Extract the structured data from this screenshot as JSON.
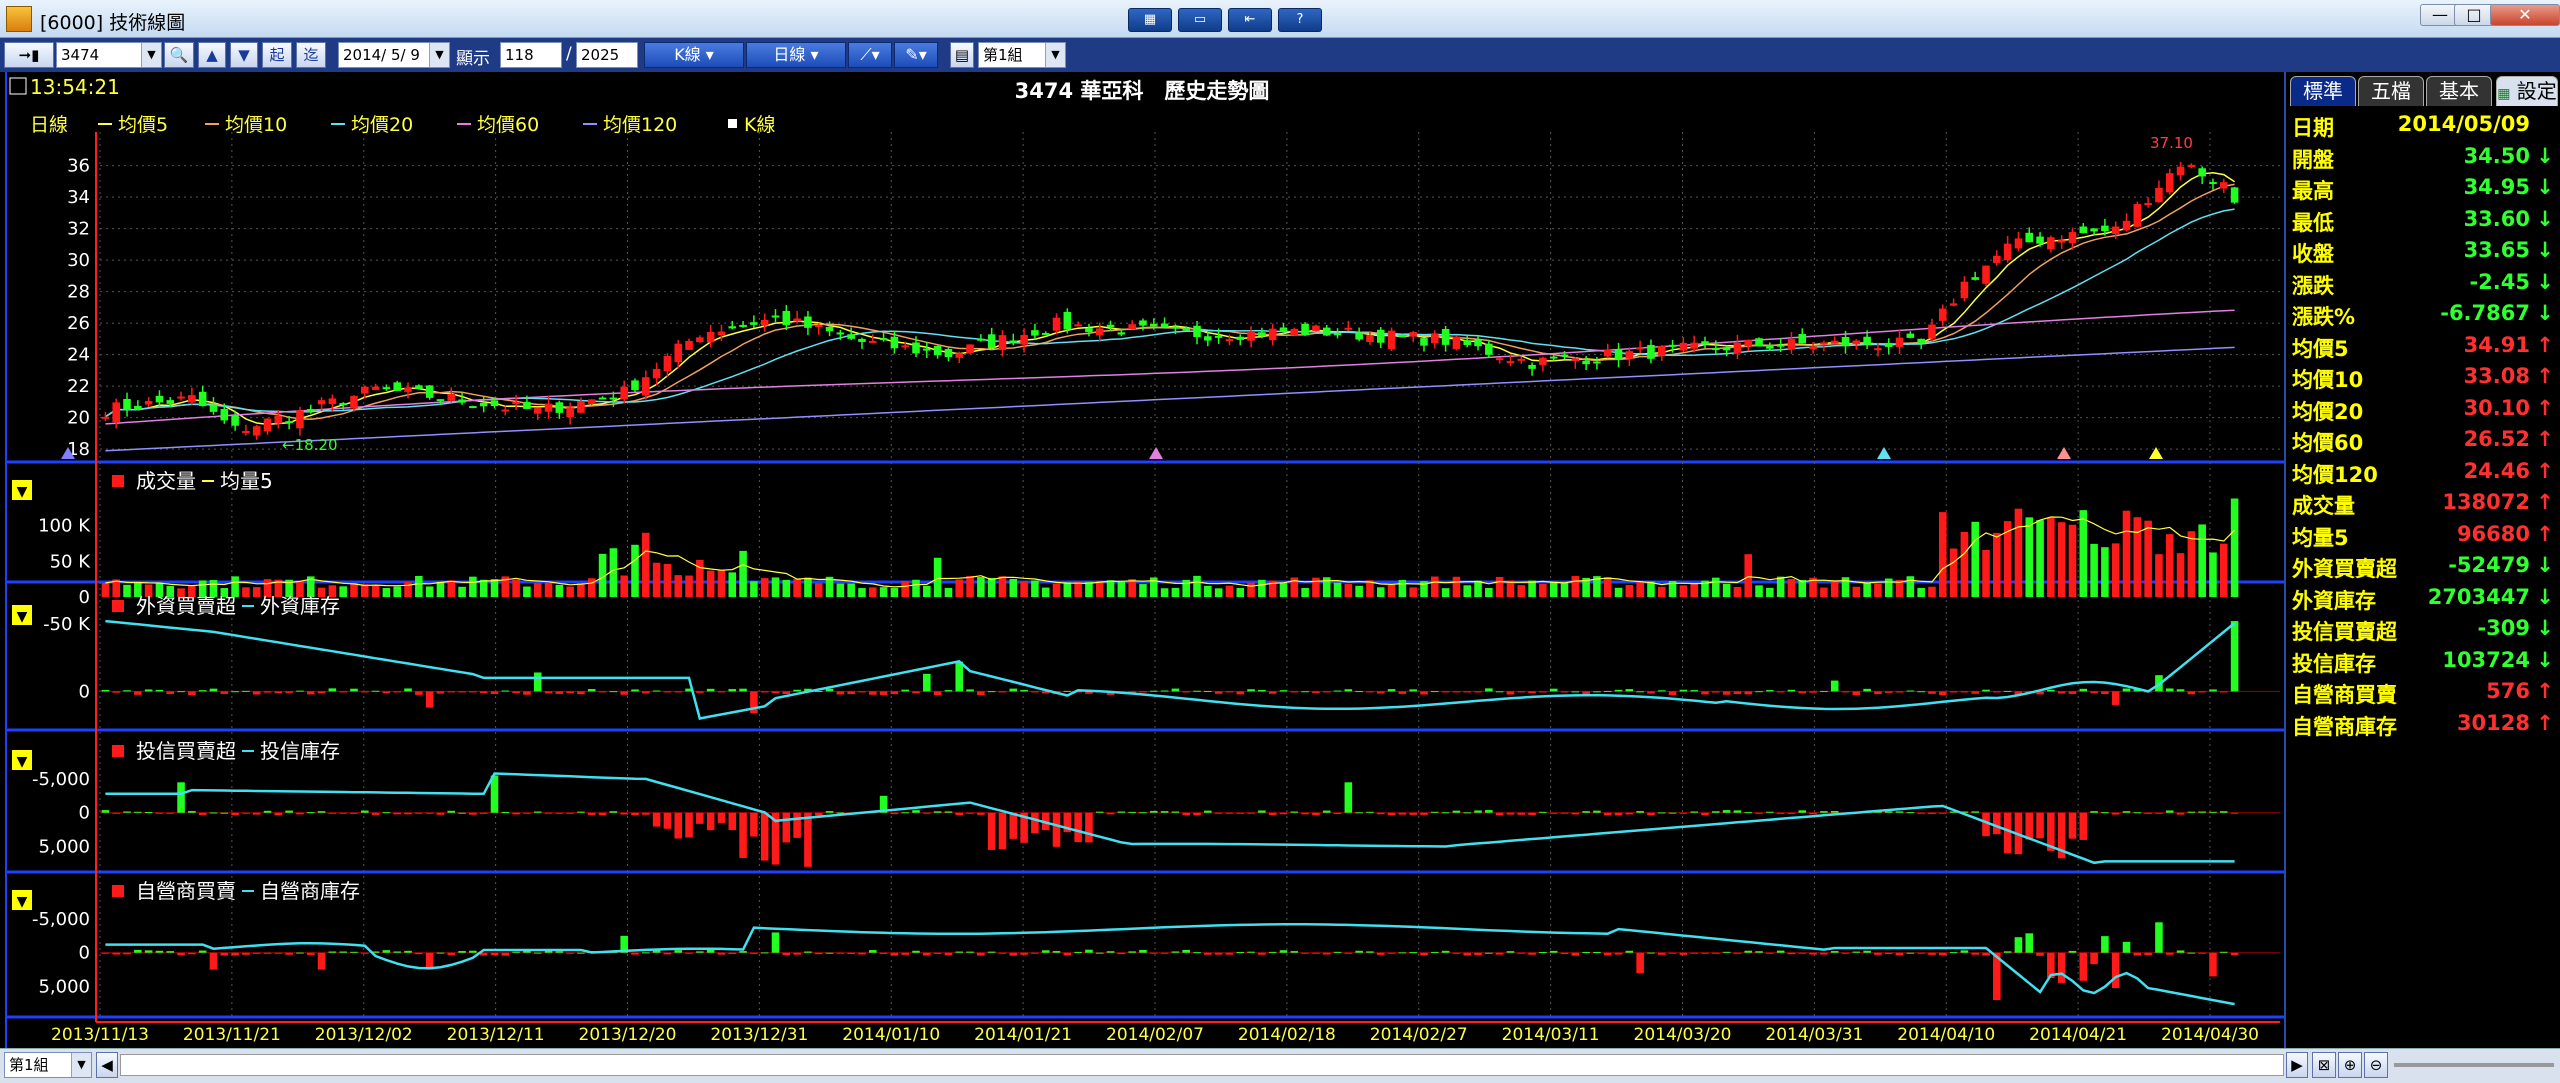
{
  "window": {
    "title": "[6000] 技術線圖",
    "btn_min": "—",
    "btn_max": "□",
    "btn_close": "✕"
  },
  "toolbar": {
    "stock_code": "3474",
    "start_label": "起",
    "end_label": "迄",
    "date": "2014/ 5/ 9",
    "show_label": "顯示",
    "show_count": "118",
    "show_sep": "/",
    "total_count": "2025",
    "kline_label": "K線",
    "period_label": "日線",
    "group_label": "第1組"
  },
  "chart": {
    "time": "13:54:21",
    "title": "3474 華亞科　歷史走勢圖",
    "legend": [
      {
        "label": "日線",
        "color": "#ffff40"
      },
      {
        "label": "均價5",
        "color": "#ffff40"
      },
      {
        "label": "均價10",
        "color": "#f0a060"
      },
      {
        "label": "均價20",
        "color": "#60e0f0"
      },
      {
        "label": "均價60",
        "color": "#e080e0"
      },
      {
        "label": "均價120",
        "color": "#9090ff"
      },
      {
        "label": "K線",
        "color": "#ffffff"
      }
    ],
    "high_mark": "37.10",
    "low_mark": "18.20",
    "panels": {
      "volume": {
        "legend": [
          "成交量",
          "均量5"
        ]
      },
      "foreign": {
        "legend": [
          "外資買賣超",
          "外資庫存"
        ]
      },
      "trust": {
        "legend": [
          "投信買賣超",
          "投信庫存"
        ]
      },
      "dealer": {
        "legend": [
          "自營商買賣",
          "自營商庫存"
        ]
      }
    },
    "dates": [
      "2013/11/13",
      "2013/11/21",
      "2013/12/02",
      "2013/12/11",
      "2013/12/20",
      "2013/12/31",
      "2014/01/10",
      "2014/01/21",
      "2014/02/07",
      "2014/02/18",
      "2014/02/27",
      "2014/03/11",
      "2014/03/20",
      "2014/03/31",
      "2014/04/10",
      "2014/04/21",
      "2014/04/30"
    ]
  },
  "chart_data": {
    "type": "line",
    "title": "3474 華亞科　歷史走勢圖",
    "price_ticks": [
      18,
      20,
      22,
      24,
      26,
      28,
      30,
      32,
      34,
      36
    ],
    "volume_ticks": [
      "100 K",
      "50 K",
      "0"
    ],
    "foreign_ticks": [
      "0",
      "-50 K"
    ],
    "trust_ticks": [
      "5,000",
      "0",
      "-5,000"
    ],
    "dealer_ticks": [
      "5,000",
      "0",
      "-5,000"
    ],
    "ylim_price": [
      17.5,
      37.5
    ],
    "close_anchors": [
      [
        0,
        20.5
      ],
      [
        8,
        21.2
      ],
      [
        12,
        19.2
      ],
      [
        18,
        20.3
      ],
      [
        25,
        21.8
      ],
      [
        32,
        21.2
      ],
      [
        40,
        20.4
      ],
      [
        48,
        21.6
      ],
      [
        55,
        25.4
      ],
      [
        62,
        26.3
      ],
      [
        70,
        24.8
      ],
      [
        78,
        24.0
      ],
      [
        88,
        25.9
      ],
      [
        100,
        25.3
      ],
      [
        112,
        25.5
      ],
      [
        124,
        24.9
      ],
      [
        132,
        23.5
      ],
      [
        140,
        24.0
      ],
      [
        152,
        24.6
      ],
      [
        163,
        24.7
      ],
      [
        168,
        24.6
      ],
      [
        172,
        28.5
      ],
      [
        176,
        30.8
      ],
      [
        180,
        31.5
      ],
      [
        186,
        31.9
      ],
      [
        192,
        36.2
      ],
      [
        196,
        34.8
      ],
      [
        197,
        33.65
      ]
    ],
    "ma_end": {
      "ma5": 34.91,
      "ma10": 33.08,
      "ma20": 30.1,
      "ma60": 26.52,
      "ma120": 24.46
    },
    "volume_end": 138072,
    "volume_ma5_end": 96680
  },
  "sidebar": {
    "tabs": [
      "標準",
      "五檔",
      "基本"
    ],
    "settings_label": "設定",
    "rows": [
      {
        "label": "日期",
        "value": "2014/05/09",
        "color": "#ffff00",
        "arrow": ""
      },
      {
        "label": "開盤",
        "value": "34.50",
        "color": "#30ff30",
        "arrow": "↓"
      },
      {
        "label": "最高",
        "value": "34.95",
        "color": "#30ff30",
        "arrow": "↓"
      },
      {
        "label": "最低",
        "value": "33.60",
        "color": "#30ff30",
        "arrow": "↓"
      },
      {
        "label": "收盤",
        "value": "33.65",
        "color": "#30ff30",
        "arrow": "↓"
      },
      {
        "label": "漲跌",
        "value": "-2.45",
        "color": "#30ff30",
        "arrow": "↓"
      },
      {
        "label": "漲跌%",
        "value": "-6.7867",
        "color": "#30ff30",
        "arrow": "↓"
      },
      {
        "label": "均價5",
        "value": "34.91",
        "color": "#ff3030",
        "arrow": "↑"
      },
      {
        "label": "均價10",
        "value": "33.08",
        "color": "#ff3030",
        "arrow": "↑"
      },
      {
        "label": "均價20",
        "value": "30.10",
        "color": "#ff3030",
        "arrow": "↑"
      },
      {
        "label": "均價60",
        "value": "26.52",
        "color": "#ff3030",
        "arrow": "↑"
      },
      {
        "label": "均價120",
        "value": "24.46",
        "color": "#ff3030",
        "arrow": "↑"
      },
      {
        "label": "成交量",
        "value": "138072",
        "color": "#ff3030",
        "arrow": "↑"
      },
      {
        "label": "均量5",
        "value": "96680",
        "color": "#ff3030",
        "arrow": "↑"
      },
      {
        "label": "外資買賣超",
        "value": "-52479",
        "color": "#30ff30",
        "arrow": "↓"
      },
      {
        "label": "外資庫存",
        "value": "2703447",
        "color": "#30ff30",
        "arrow": "↓"
      },
      {
        "label": "投信買賣超",
        "value": "-309",
        "color": "#30ff30",
        "arrow": "↓"
      },
      {
        "label": "投信庫存",
        "value": "103724",
        "color": "#30ff30",
        "arrow": "↓"
      },
      {
        "label": "自營商買賣",
        "value": "576",
        "color": "#ff3030",
        "arrow": "↑"
      },
      {
        "label": "自營商庫存",
        "value": "30128",
        "color": "#ff3030",
        "arrow": "↑"
      }
    ]
  },
  "statusbar": {
    "group": "第1組"
  },
  "colors": {
    "up": "#ff1a1a",
    "down": "#20ff20",
    "axis": "#ff2020",
    "divider": "#2040ff",
    "grid": "#555555",
    "text": "#ffffff",
    "label": "#ffff40",
    "inventory": "#40e0f0"
  }
}
